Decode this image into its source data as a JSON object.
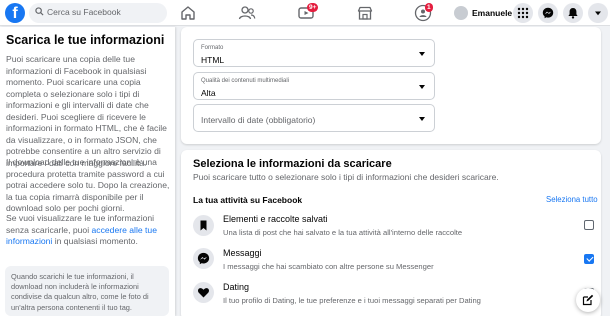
{
  "header": {
    "logo": "f",
    "search_placeholder": "Cerca su Facebook",
    "nav": [
      {
        "icon": "home-icon"
      },
      {
        "icon": "friends-icon"
      },
      {
        "icon": "video-icon",
        "badge": "9+"
      },
      {
        "icon": "marketplace-icon"
      },
      {
        "icon": "groups-icon",
        "badge": "1"
      }
    ],
    "profile_name": "Emanuele",
    "right_buttons": [
      "menu-grid-icon",
      "messenger-icon",
      "notifications-icon",
      "account-caret-icon"
    ]
  },
  "sidebar": {
    "title": "Scarica le tue informazioni",
    "paragraph1": "Puoi scaricare una copia delle tue informazioni di Facebook in qualsiasi momento. Puoi scaricare una copia completa o selezionare solo i tipi di informazioni e gli intervalli di date che desideri. Puoi scegliere di ricevere le informazioni in formato HTML, che è facile da visualizzare, o in formato JSON, che potrebbe consentire a un altro servizio di importare i dati con maggiore facilità.",
    "paragraph2": "Il download delle tue informazioni è una procedura protetta tramite password a cui potrai accedere solo tu. Dopo la creazione, la tua copia rimarrà disponibile per il download solo per pochi giorni.",
    "paragraph3_before": "Se vuoi visualizzare le tue informazioni senza scaricarle, puoi ",
    "paragraph3_link": "accedere alle tue informazioni",
    "paragraph3_after": " in qualsiasi momento.",
    "note": "Quando scarichi le tue informazioni, il download non includerà le informazioni condivise da qualcun altro, come le foto di un'altra persona contenenti il tuo tag."
  },
  "options": {
    "format_label": "Formato",
    "format_value": "HTML",
    "quality_label": "Qualità dei contenuti multimediali",
    "quality_value": "Alta",
    "date_placeholder": "Intervallo di date (obbligatorio)"
  },
  "select_section": {
    "title": "Seleziona le informazioni da scaricare",
    "subtitle": "Puoi scaricare tutto o selezionare solo i tipi di informazioni che desideri scaricare.",
    "group_title": "La tua attività su Facebook",
    "select_all": "Seleziona tutto",
    "items": [
      {
        "title": "Elementi e raccolte salvati",
        "desc": "Una lista di post che hai salvato e la tua attività all'interno delle raccolte",
        "checked": false,
        "icon": "bookmark-icon"
      },
      {
        "title": "Messaggi",
        "desc": "I messaggi che hai scambiato con altre persone su Messenger",
        "checked": true,
        "icon": "messenger-icon"
      },
      {
        "title": "Dating",
        "desc": "Il tuo profilo di Dating, le tue preferenze e i tuoi messaggi separati per Dating",
        "checked": false,
        "icon": "dating-heart-icon"
      }
    ]
  },
  "colors": {
    "brand": "#1877f2",
    "badge": "#e41e3f"
  }
}
